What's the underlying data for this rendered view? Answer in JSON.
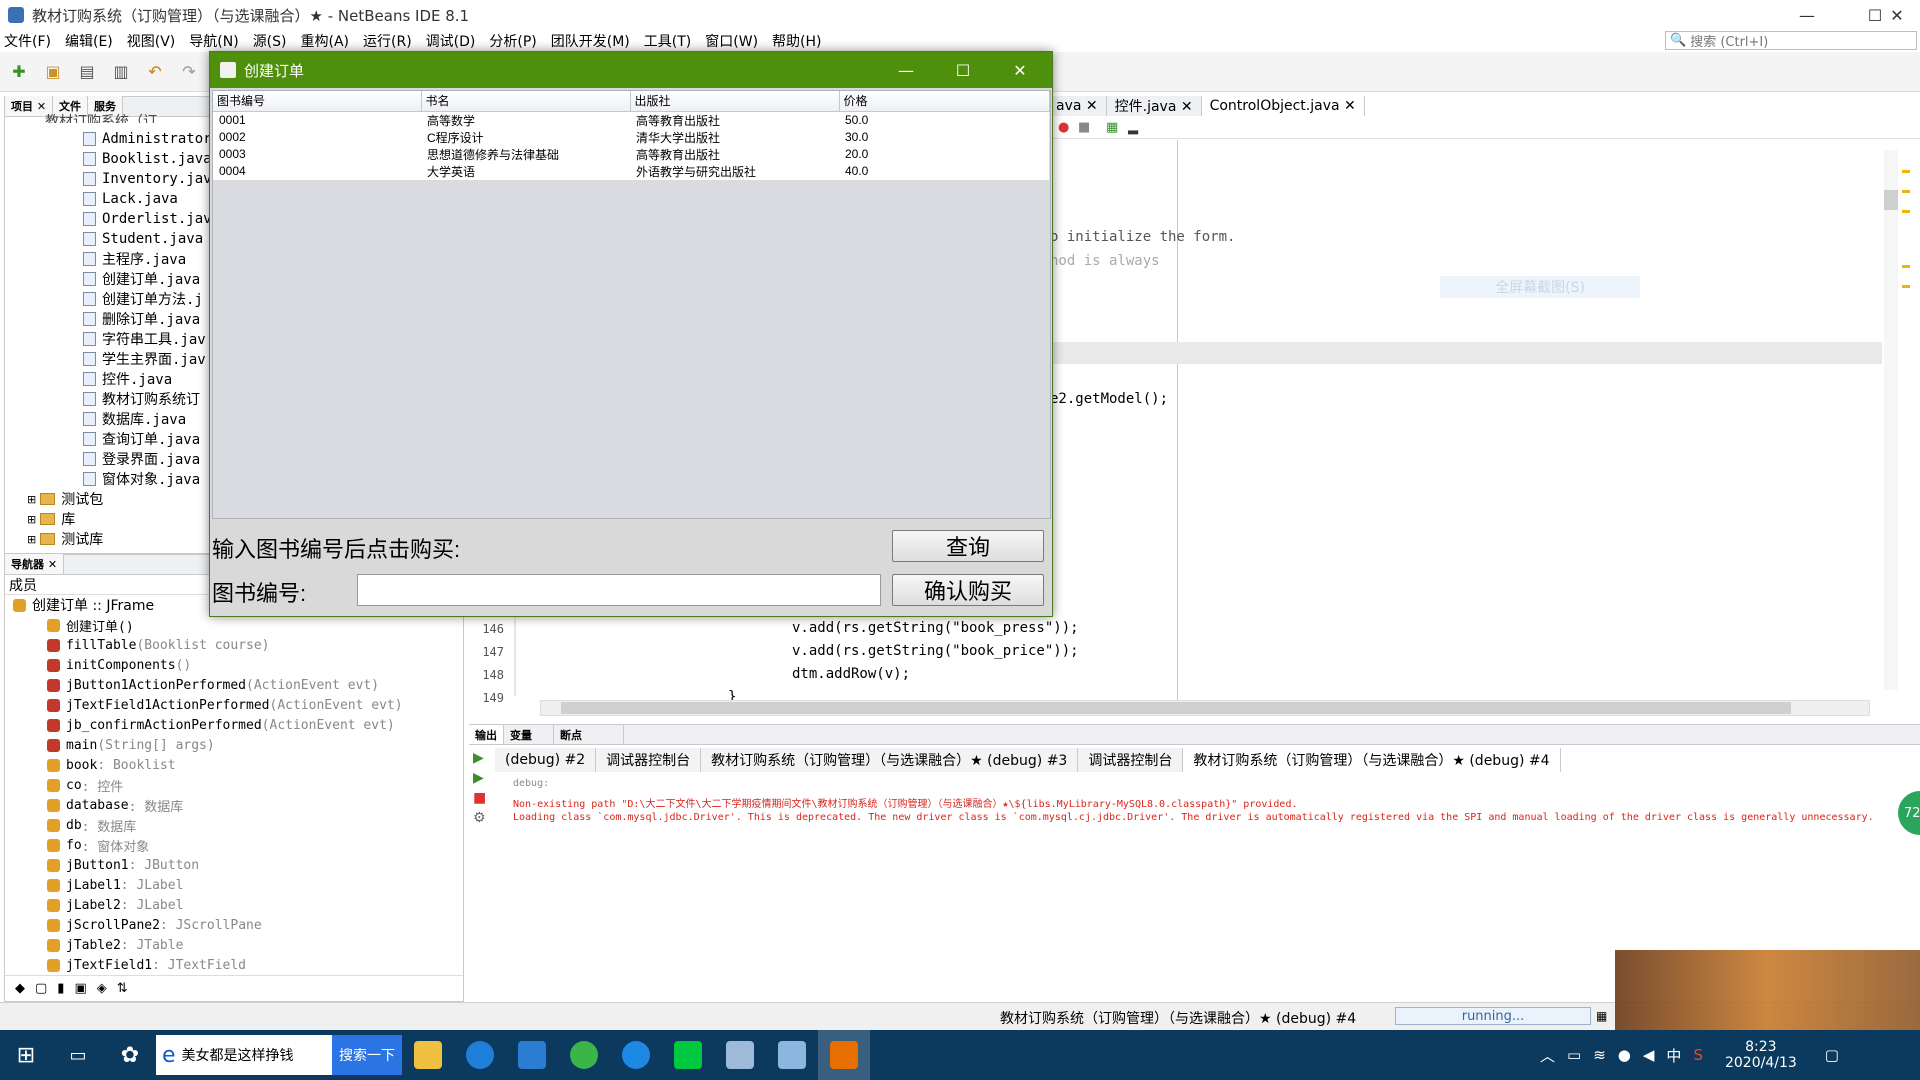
{
  "window": {
    "title": "教材订购系统（订购管理）（与选课融合）★ - NetBeans IDE 8.1",
    "minimize": "—",
    "maximize": "☐",
    "close": "✕"
  },
  "menu": [
    "文件(F)",
    "编辑(E)",
    "视图(V)",
    "导航(N)",
    "源(S)",
    "重构(A)",
    "运行(R)",
    "调试(D)",
    "分析(P)",
    "团队开发(M)",
    "工具(T)",
    "窗口(W)",
    "帮助(H)"
  ],
  "search": {
    "placeholder": "搜索 (Ctrl+I)"
  },
  "project_panel": {
    "tabs": [
      "项目 ✕",
      "文件",
      "服务"
    ],
    "partial_root": "教材订购系统（订",
    "files": [
      "Administrator",
      "Booklist.java",
      "Inventory.jav",
      "Lack.java",
      "Orderlist.jav",
      "Student.java",
      "主程序.java",
      "创建订单.java",
      "创建订单方法.j",
      "删除订单.java",
      "字符串工具.jav",
      "学生主界面.jav",
      "控件.java",
      "教材订购系统订",
      "数据库.java",
      "查询订单.java",
      "登录界面.java",
      "窗体对象.java"
    ],
    "folders": [
      "测试包",
      "库",
      "测试库"
    ]
  },
  "navigator": {
    "tab": "导航器 ✕",
    "filter": "成员",
    "root": "创建订单 :: JFrame",
    "members": [
      {
        "name": "创建订单()",
        "type": "",
        "color": "#e0a126"
      },
      {
        "name": "fillTable",
        "type": "(Booklist course)",
        "color": "#c0392b"
      },
      {
        "name": "initComponents",
        "type": "()",
        "color": "#c0392b"
      },
      {
        "name": "jButton1ActionPerformed",
        "type": "(ActionEvent evt)",
        "color": "#c0392b"
      },
      {
        "name": "jTextField1ActionPerformed",
        "type": "(ActionEvent evt)",
        "color": "#c0392b"
      },
      {
        "name": "jb_confirmActionPerformed",
        "type": "(ActionEvent evt)",
        "color": "#c0392b"
      },
      {
        "name": "main",
        "type": "(String[] args)",
        "color": "#c0392b"
      },
      {
        "name": "book",
        "type": " : Booklist",
        "color": "#e0a126"
      },
      {
        "name": "co",
        "type": " : 控件",
        "color": "#e0a126"
      },
      {
        "name": "database",
        "type": " : 数据库",
        "color": "#e0a126"
      },
      {
        "name": "db",
        "type": " : 数据库",
        "color": "#e0a126"
      },
      {
        "name": "fo",
        "type": " : 窗体对象",
        "color": "#e0a126"
      },
      {
        "name": "jButton1",
        "type": " : JButton",
        "color": "#e0a126"
      },
      {
        "name": "jLabel1",
        "type": " : JLabel",
        "color": "#e0a126"
      },
      {
        "name": "jLabel2",
        "type": " : JLabel",
        "color": "#e0a126"
      },
      {
        "name": "jScrollPane2",
        "type": " : JScrollPane",
        "color": "#e0a126"
      },
      {
        "name": "jTable2",
        "type": " : JTable",
        "color": "#e0a126"
      },
      {
        "name": "jTextField1",
        "type": " : JTextField",
        "color": "#e0a126"
      }
    ]
  },
  "editor": {
    "tabs": [
      "ava ✕",
      "控件.java ✕",
      "ControlObject.java ✕"
    ],
    "snippets": {
      "init": "o initialize the form.",
      "always": "hod is always",
      "getmodel": "e2.getModel();",
      "watermark": "全屏幕截图(S)"
    },
    "lines": [
      {
        "no": "146",
        "code": "v.add(rs.getString(\"book_press\"));"
      },
      {
        "no": "147",
        "code": "v.add(rs.getString(\"book_price\"));"
      },
      {
        "no": "148",
        "code": "dtm.addRow(v);"
      },
      {
        "no": "149",
        "code": "}"
      }
    ]
  },
  "dialog": {
    "title": "创建订单",
    "columns": [
      "图书编号",
      "书名",
      "出版社",
      "价格"
    ],
    "rows": [
      [
        "0001",
        "高等数学",
        "高等教育出版社",
        "50.0"
      ],
      [
        "0002",
        "C程序设计",
        "清华大学出版社",
        "30.0"
      ],
      [
        "0003",
        "思想道德修养与法律基础",
        "高等教育出版社",
        "20.0"
      ],
      [
        "0004",
        "大学英语",
        "外语教学与研究出版社",
        "40.0"
      ]
    ],
    "prompt_label": "输入图书编号后点击购买:",
    "query_button": "查询",
    "bookno_label": "图书编号:",
    "bookno_value": "",
    "confirm_button": "确认购买"
  },
  "output": {
    "side_tabs": [
      "输出",
      "变量",
      "断点"
    ],
    "tabs": [
      "(debug) #2",
      "调试器控制台",
      "教材订购系统（订购管理）（与选课融合）★ (debug) #3",
      "调试器控制台",
      "教材订购系统（订购管理）（与选课融合）★ (debug) #4"
    ],
    "lines": [
      {
        "text": "debug:",
        "color": "#8a8a8a"
      },
      {
        "text": "Non-existing path \"D:\\大二下文件\\大二下学期疫情期间文件\\教材订购系统（订购管理）（与选课融合）★\\${libs.MyLibrary-MySQL8.0.classpath}\" provided.",
        "color": "#d9261c"
      },
      {
        "text": "Loading class `com.mysql.jdbc.Driver'. This is deprecated. The new driver class is `com.mysql.cj.jdbc.Driver'. The driver is automatically registered via the SPI and manual loading of the driver class is generally unnecessary.",
        "color": "#d9261c"
      }
    ]
  },
  "statusbar": {
    "process": "教材订购系统（订购管理）（与选课融合）★ (debug) #4",
    "progress": "running...",
    "badge": "72"
  },
  "taskbar": {
    "search_prompt": "美女都是这样挣钱",
    "search_button": "搜索一下",
    "ime": "中",
    "time": "8:23",
    "date": "2020/4/13"
  }
}
